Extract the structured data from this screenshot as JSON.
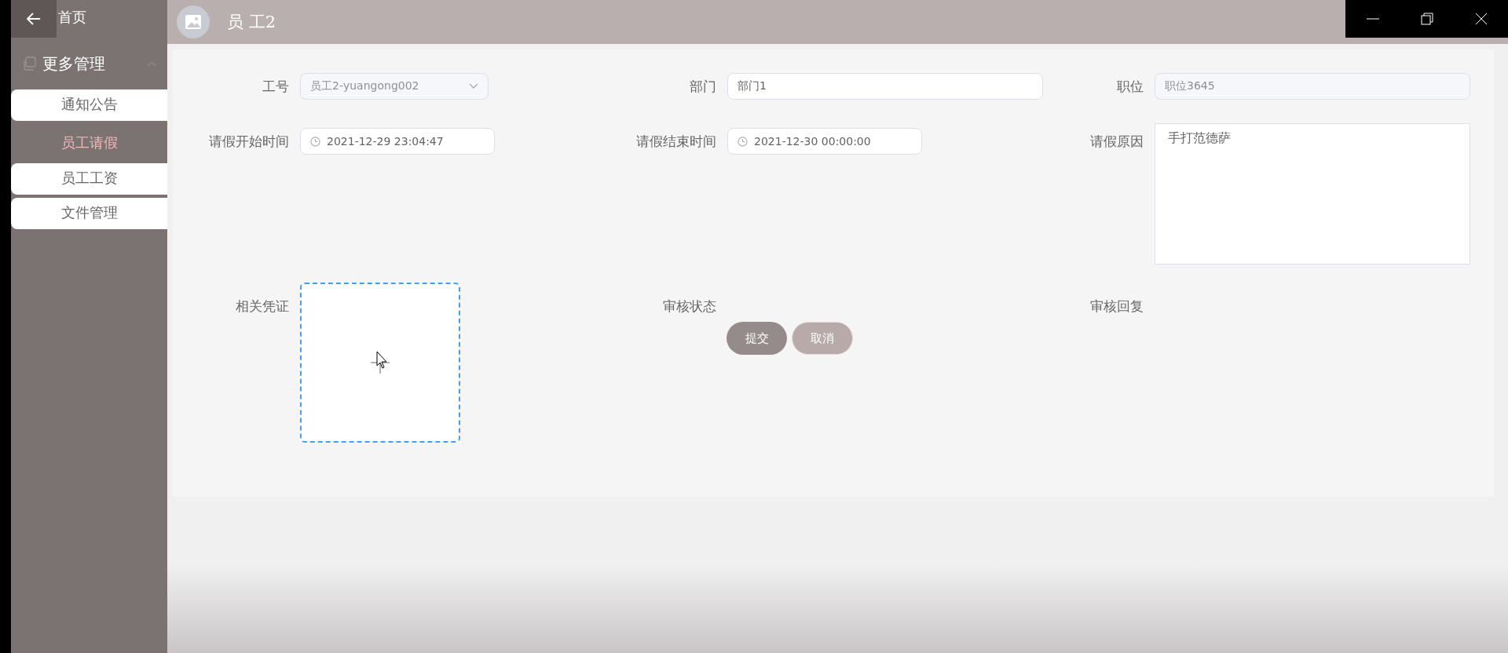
{
  "sidebar": {
    "home": "首页",
    "group": {
      "label": "更多管理",
      "expanded": true
    },
    "items": [
      {
        "label": "通知公告",
        "selected": false
      },
      {
        "label": "员工请假",
        "selected": true
      },
      {
        "label": "员工工资",
        "selected": false
      },
      {
        "label": "文件管理",
        "selected": false
      }
    ]
  },
  "header": {
    "title": "员 工2"
  },
  "form": {
    "fields": [
      {
        "kind": "select",
        "label": "工号",
        "value": "员工2-yuangong002",
        "disabled": true
      },
      {
        "kind": "input",
        "label": "部门",
        "value": "部门1",
        "disabled": false
      },
      {
        "kind": "input",
        "label": "职位",
        "value": "职位3645",
        "disabled": true
      },
      {
        "kind": "date",
        "label": "请假开始时间",
        "value": "2021-12-29 23:04:47"
      },
      {
        "kind": "date",
        "label": "请假结束时间",
        "value": "2021-12-30 00:00:00"
      },
      {
        "kind": "textarea",
        "label": "请假原因",
        "value": "手打范德萨"
      },
      {
        "kind": "upload",
        "label": "相关凭证"
      },
      {
        "kind": "empty",
        "label": "审核状态"
      },
      {
        "kind": "empty",
        "label": "审核回复"
      }
    ],
    "buttons": [
      {
        "label": "提交",
        "kind": "primary"
      },
      {
        "label": "取消",
        "kind": "secondary"
      }
    ]
  }
}
